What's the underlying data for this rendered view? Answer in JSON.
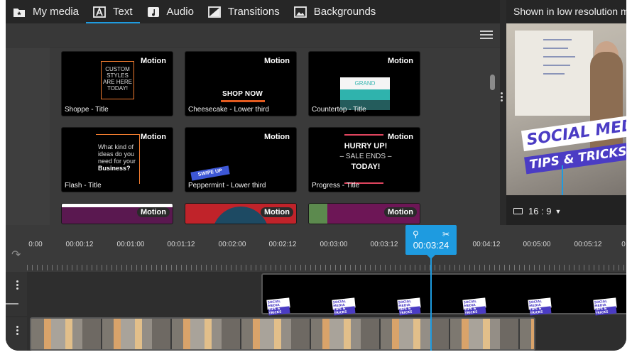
{
  "tabs": [
    {
      "label": "My media",
      "icon": "star-folder-icon",
      "active": false
    },
    {
      "label": "Text",
      "icon": "text-a-icon",
      "active": true
    },
    {
      "label": "Audio",
      "icon": "music-note-icon",
      "active": false
    },
    {
      "label": "Transitions",
      "icon": "transition-icon",
      "active": false
    },
    {
      "label": "Backgrounds",
      "icon": "image-icon",
      "active": false
    }
  ],
  "templates": {
    "badge": "Motion",
    "items": [
      {
        "name": "Shoppe - Title",
        "art": "CUSTOM STYLES ARE HERE TODAY!"
      },
      {
        "name": "Cheesecake - Lower third",
        "art": "SHOP NOW"
      },
      {
        "name": "Countertop - Title",
        "art": "GRAND OPENING!"
      },
      {
        "name": "Flash - Title",
        "art": "What kind of ideas do you need for your",
        "art_bold": "Business?"
      },
      {
        "name": "Peppermint - Lower third",
        "art": "SWIPE UP"
      },
      {
        "name": "Progress - Title",
        "art_l1": "HURRY UP!",
        "art_l2": "– SALE ENDS –",
        "art_l3": "TODAY!"
      }
    ]
  },
  "preview": {
    "low_res_notice": "Shown in low resolution m",
    "banner_line1": "SOCIAL MEDIA",
    "banner_line2": "TIPS & TRICKS",
    "aspect_ratio": "16 : 9"
  },
  "timeline": {
    "ticks": [
      "0:00",
      "00:00:12",
      "00:01:00",
      "00:01:12",
      "00:02:00",
      "00:02:12",
      "00:03:00",
      "00:03:12",
      "00:04:12",
      "00:05:00",
      "00:05:12",
      "0"
    ],
    "playhead_time": "00:03:24",
    "mini_line1": "SOCIAL MEDIA",
    "mini_line2": "TIPS & TRICKS"
  },
  "colors": {
    "accent": "#1e9be0",
    "brand_purple": "#4b3cc4",
    "orange": "#ef7b2f"
  }
}
